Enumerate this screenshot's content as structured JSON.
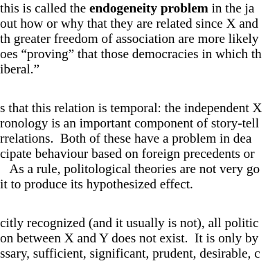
{
  "document": {
    "lines": [
      {
        "pre": "this is called the ",
        "bold": "endogeneity problem",
        "post": " in the ja"
      },
      {
        "text": "out how or why that they are related since X and"
      },
      {
        "text": "th greater freedom of association are more likely"
      },
      {
        "text": "oes “proving” that those democracies in which th"
      },
      {
        "text": "iberal.”"
      },
      {
        "text": "s that this relation is temporal: the independent X"
      },
      {
        "text": "ronology is an important component of story-tell"
      },
      {
        "text": "rrelations.  Both of these have a problem in dea"
      },
      {
        "text": "cipate behaviour based on foreign precedents or"
      },
      {
        "text": "   As a rule, politological theories are not very go"
      },
      {
        "text": "it to produce its hypothesized effect."
      },
      {
        "text": "citly recognized (and it usually is not), all politic"
      },
      {
        "text": "on between X and Y does not exist.  It is only by"
      },
      {
        "text": "ssary, sufficient, significant, prudent, desirable, c"
      }
    ]
  }
}
